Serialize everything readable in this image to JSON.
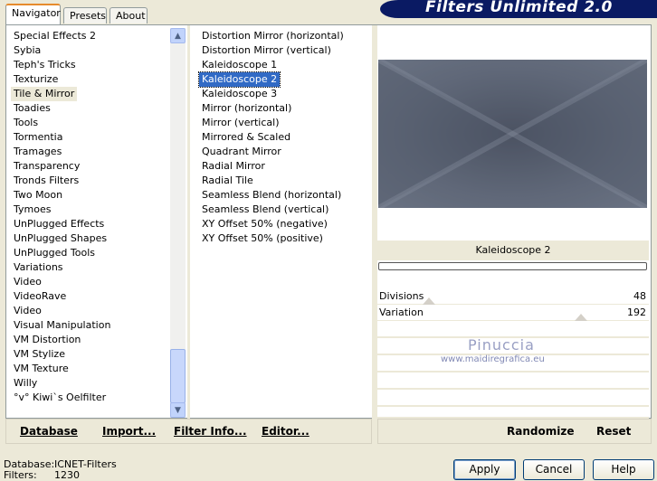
{
  "tabs": [
    {
      "label": "Navigator"
    },
    {
      "label": "Presets"
    },
    {
      "label": "About"
    }
  ],
  "banner": {
    "title": "Filters Unlimited 2.0"
  },
  "categories": [
    "Special Effects 2",
    "Sybia",
    "Teph's Tricks",
    "Texturize",
    "Tile & Mirror",
    "Toadies",
    "Tools",
    "Tormentia",
    "Tramages",
    "Transparency",
    "Tronds Filters",
    "Two Moon",
    "Tymoes",
    "UnPlugged Effects",
    "UnPlugged Shapes",
    "UnPlugged Tools",
    "Variations",
    "Video",
    "VideoRave",
    "Video",
    "Visual Manipulation",
    "VM Distortion",
    "VM Stylize",
    "VM Texture",
    "Willy",
    "°v° Kiwi`s Oelfilter"
  ],
  "filters": [
    "Distortion Mirror (horizontal)",
    "Distortion Mirror (vertical)",
    "Kaleidoscope 1",
    "Kaleidoscope 2",
    "Kaleidoscope 3",
    "Mirror (horizontal)",
    "Mirror (vertical)",
    "Mirrored & Scaled",
    "Quadrant Mirror",
    "Radial Mirror",
    "Radial Tile",
    "Seamless Blend (horizontal)",
    "Seamless Blend (vertical)",
    "XY Offset 50% (negative)",
    "XY Offset 50% (positive)"
  ],
  "selected_category": "Tile & Mirror",
  "selected_filter": "Kaleidoscope 2",
  "preview": {
    "caption": "Kaleidoscope 2"
  },
  "sliders": [
    {
      "label": "Divisions",
      "value": "48",
      "fraction": 0.19
    },
    {
      "label": "Variation",
      "value": "192",
      "fraction": 0.75
    }
  ],
  "watermark": {
    "name": "Pinuccia",
    "url": "www.maidiregrafica.eu"
  },
  "toolbar": {
    "database": "Database",
    "import": "Import...",
    "filter_info": "Filter Info...",
    "editor": "Editor...",
    "randomize": "Randomize",
    "reset": "Reset"
  },
  "status": {
    "database_label": "Database:",
    "database_value": "ICNET-Filters",
    "filters_label": "Filters:",
    "filters_value": "1230"
  },
  "buttons": {
    "apply": "Apply",
    "cancel": "Cancel",
    "help": "Help"
  },
  "colors": {
    "selection": "#316ac5",
    "banner": "#0a1a63"
  }
}
